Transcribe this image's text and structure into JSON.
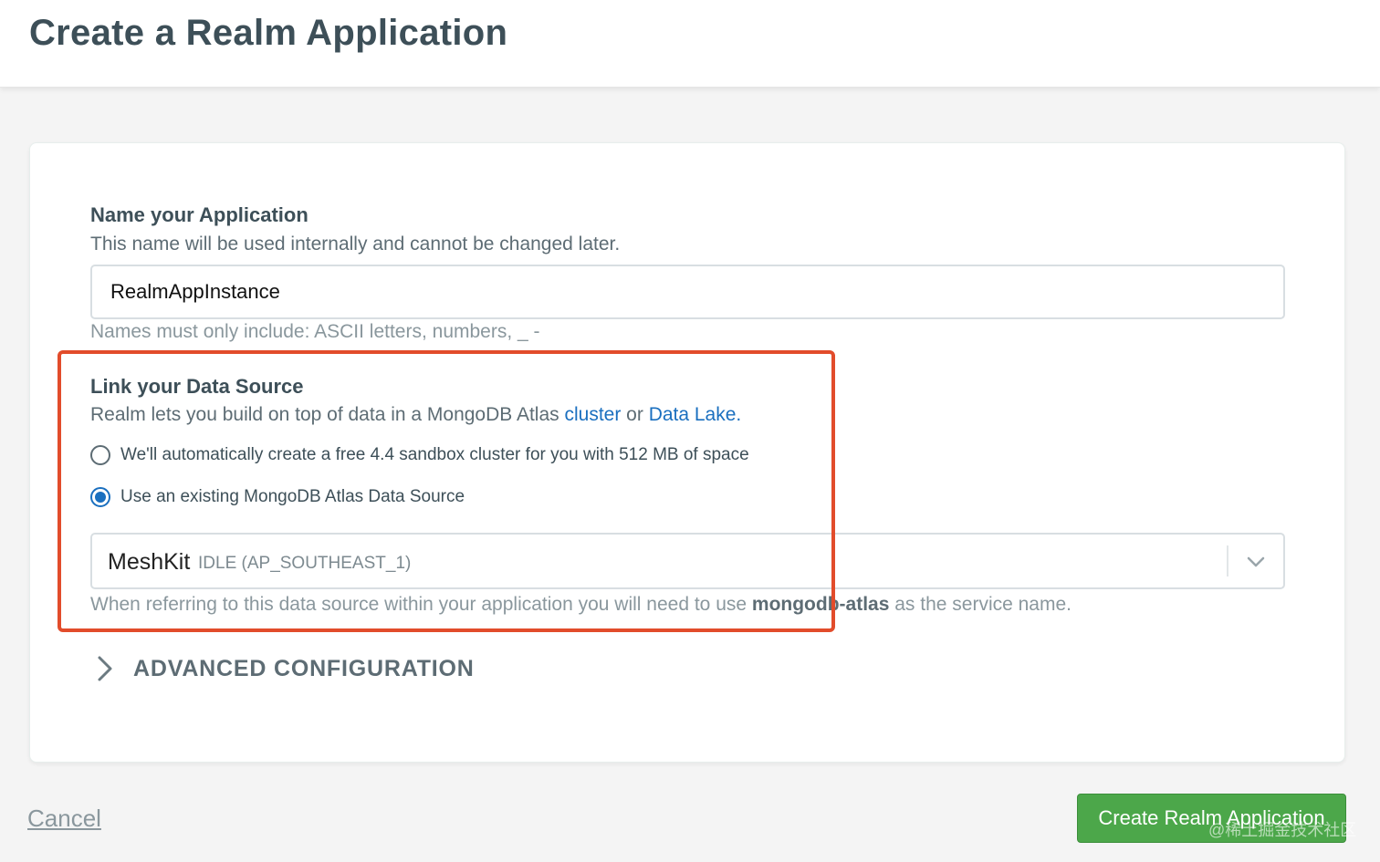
{
  "page": {
    "title": "Create a Realm Application"
  },
  "name_section": {
    "title": "Name your Application",
    "description": "This name will be used internally and cannot be changed later.",
    "input_value": "RealmAppInstance",
    "hint": "Names must only include: ASCII letters, numbers, _ -"
  },
  "data_source_section": {
    "title": "Link your Data Source",
    "description_prefix": "Realm lets you build on top of data in a MongoDB Atlas ",
    "link_cluster": "cluster",
    "description_or": " or ",
    "link_data_lake": "Data Lake",
    "description_suffix": ".",
    "radio_options": [
      {
        "label": "We'll automatically create a free 4.4 sandbox cluster for you with 512 MB of space",
        "checked": false
      },
      {
        "label": "Use an existing MongoDB Atlas Data Source",
        "checked": true
      }
    ],
    "selected_source": "MeshKit",
    "selected_status": "IDLE (AP_SOUTHEAST_1)",
    "service_hint_prefix": "When referring to this data source within your application you will need to use ",
    "service_name": "mongodb-atlas",
    "service_hint_suffix": " as the service name."
  },
  "advanced": {
    "label": "ADVANCED CONFIGURATION"
  },
  "footer": {
    "cancel_label": "Cancel",
    "create_label": "Create Realm Application",
    "watermark": "@稀土掘金技术社区"
  },
  "colors": {
    "accent_blue": "#1a6fbf",
    "primary_green": "#4ca74a",
    "highlight_red": "#e24c2b"
  }
}
